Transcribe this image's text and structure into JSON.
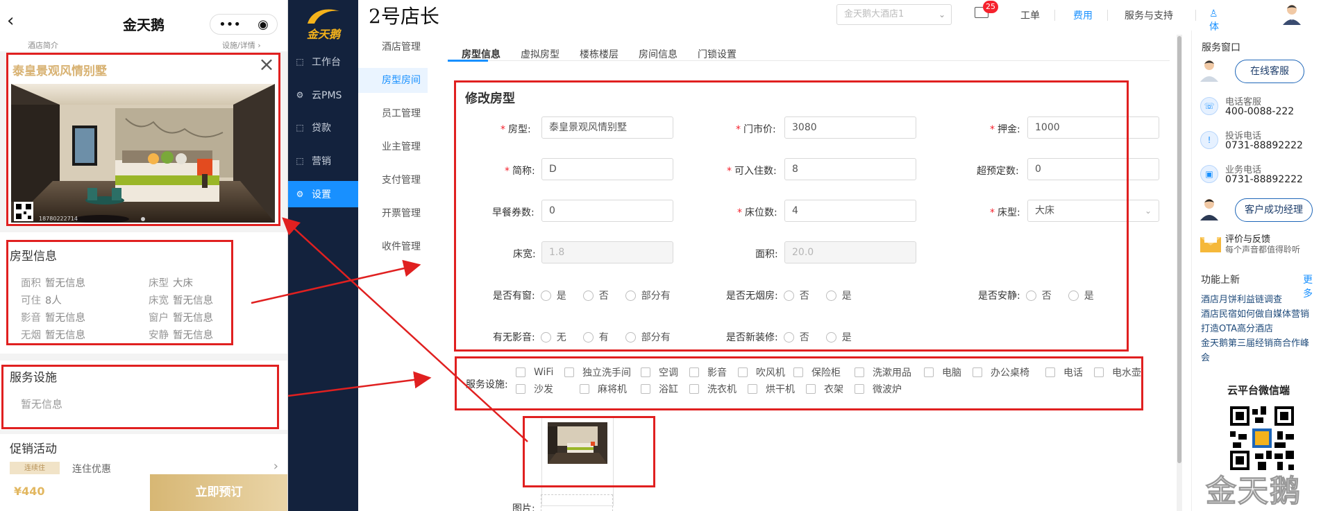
{
  "mobile": {
    "title": "金天鹅",
    "back_icon": "chevron-left-icon",
    "menu_glyph": "•••",
    "subbar_left": "酒店简介",
    "subbar_right": "设施/详情 ›",
    "room_name": "泰皇景观风情别墅",
    "photo_overlay_text": "18780222714",
    "info_title": "房型信息",
    "info_items": [
      {
        "label": "面积",
        "value": "暂无信息"
      },
      {
        "label": "床型",
        "value": "大床"
      },
      {
        "label": "可住",
        "value": "8人"
      },
      {
        "label": "床宽",
        "value": "暂无信息"
      },
      {
        "label": "影音",
        "value": "暂无信息"
      },
      {
        "label": "窗户",
        "value": "暂无信息"
      },
      {
        "label": "无烟",
        "value": "暂无信息"
      },
      {
        "label": "安静",
        "value": "暂无信息"
      }
    ],
    "service_title": "服务设施",
    "service_empty": "暂无信息",
    "promo_title": "促销活动",
    "promo_tag": "连续住",
    "promo_text": "连住优惠",
    "price": "¥440",
    "book_label": "立即预订"
  },
  "nav": {
    "logo_text": "金天鹅",
    "items": [
      {
        "label": "工作台",
        "icon": "workbench-icon",
        "active": false
      },
      {
        "label": "云PMS",
        "icon": "gear-icon",
        "active": false
      },
      {
        "label": "贷款",
        "icon": "loan-icon",
        "active": false
      },
      {
        "label": "营销",
        "icon": "marketing-icon",
        "active": false
      },
      {
        "label": "设置",
        "icon": "settings-icon",
        "active": true
      }
    ]
  },
  "subnav": {
    "items": [
      {
        "label": "酒店管理",
        "active": false
      },
      {
        "label": "房型房间",
        "active": true
      },
      {
        "label": "员工管理",
        "active": false
      },
      {
        "label": "业主管理",
        "active": false
      },
      {
        "label": "支付管理",
        "active": false
      },
      {
        "label": "开票管理",
        "active": false
      },
      {
        "label": "收件管理",
        "active": false
      }
    ]
  },
  "header": {
    "store_title": "2号店长",
    "hotel_select": "金天鹅大酒店1",
    "mail_badge": "25",
    "links": [
      "工单",
      "费用",
      "服务与支持",
      "♙体验账号勿删"
    ]
  },
  "tabs": [
    "房型信息",
    "虚拟房型",
    "楼栋楼层",
    "房间信息",
    "门锁设置"
  ],
  "form": {
    "title": "修改房型",
    "fields": [
      {
        "label": "房型:",
        "required": true,
        "value": "泰皇景观风情别墅"
      },
      {
        "label": "门市价:",
        "required": true,
        "value": "3080"
      },
      {
        "label": "押金:",
        "required": true,
        "value": "1000"
      },
      {
        "label": "简称:",
        "required": true,
        "value": "D"
      },
      {
        "label": "可入住数:",
        "required": true,
        "value": "8"
      },
      {
        "label": "超预定数:",
        "required": false,
        "value": "0"
      },
      {
        "label": "早餐券数:",
        "required": false,
        "value": "0"
      },
      {
        "label": "床位数:",
        "required": true,
        "value": "4"
      },
      {
        "label": "床型:",
        "required": true,
        "value": "大床"
      },
      {
        "label": "床宽:",
        "required": false,
        "value": "1.8"
      },
      {
        "label": "面积:",
        "required": false,
        "value": "20.0"
      }
    ],
    "radios": [
      {
        "label": "是否有窗:",
        "options": [
          "是",
          "否",
          "部分有"
        ]
      },
      {
        "label": "是否无烟房:",
        "options": [
          "否",
          "是"
        ]
      },
      {
        "label": "是否安静:",
        "options": [
          "否",
          "是"
        ]
      },
      {
        "label": "有无影音:",
        "options": [
          "无",
          "有",
          "部分有"
        ]
      },
      {
        "label": "是否新装修:",
        "options": [
          "否",
          "是"
        ]
      }
    ],
    "service_label": "服务设施:",
    "services_row1": [
      "WiFi",
      "独立洗手间",
      "空调",
      "影音",
      "吹风机",
      "保险柜",
      "洗漱用品",
      "电脑",
      "办公桌椅",
      "电话",
      "电水壶"
    ],
    "services_row2": [
      "沙发",
      "麻将机",
      "浴缸",
      "洗衣机",
      "烘干机",
      "衣架",
      "微波炉"
    ],
    "picture_label": "图片:"
  },
  "rpanel": {
    "title": "服务窗口",
    "online_service": "在线客服",
    "phone_label": "电话客服",
    "phone_value": "400-0088-222",
    "complaint_label": "投诉电话",
    "complaint_value": "0731-88892222",
    "business_label": "业务电话",
    "business_value": "0731-88892222",
    "manager_button": "客户成功经理",
    "feedback_label": "评价与反馈",
    "feedback_sub": "每个声音都值得聆听",
    "news_title": "功能上新",
    "news_more": "更多",
    "news_items": [
      "酒店月饼利益链调查",
      "酒店民宿如何做自媒体营销",
      "打造OTA高分酒店",
      "金天鹅第三届经销商合作峰",
      "会"
    ],
    "wechat_title": "云平台微信端",
    "watermark": "金天鹅"
  },
  "colors": {
    "nav_bg": "#13223d",
    "accent": "#1890ff",
    "annotation": "#e02020",
    "gold": "#d8b272",
    "logo_gold": "#f4b21b"
  }
}
